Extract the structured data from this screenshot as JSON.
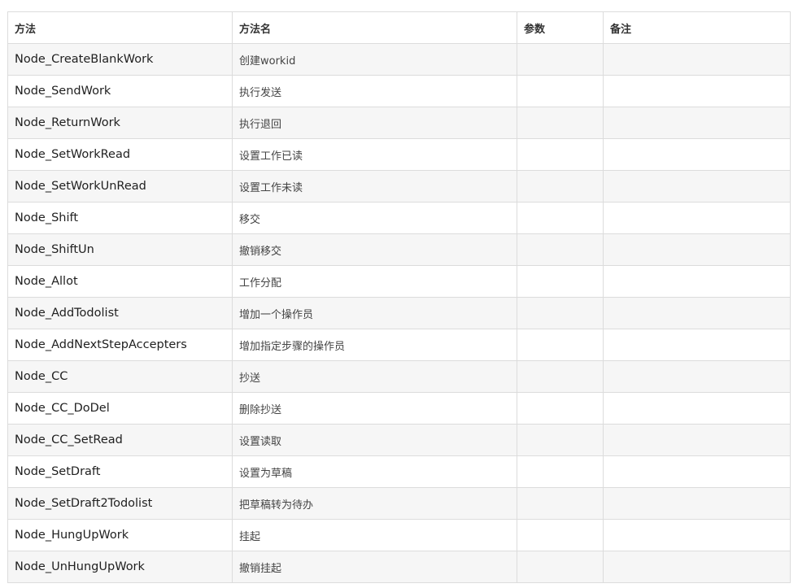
{
  "table": {
    "headers": [
      "方法",
      "方法名",
      "参数",
      "备注"
    ],
    "rows": [
      {
        "method": "Node_CreateBlankWork",
        "name": "创建workid",
        "params": "",
        "note": ""
      },
      {
        "method": "Node_SendWork",
        "name": "执行发送",
        "params": "",
        "note": ""
      },
      {
        "method": "Node_ReturnWork",
        "name": "执行退回",
        "params": "",
        "note": ""
      },
      {
        "method": "Node_SetWorkRead",
        "name": "设置工作已读",
        "params": "",
        "note": ""
      },
      {
        "method": "Node_SetWorkUnRead",
        "name": "设置工作未读",
        "params": "",
        "note": ""
      },
      {
        "method": "Node_Shift",
        "name": "移交",
        "params": "",
        "note": ""
      },
      {
        "method": "Node_ShiftUn",
        "name": "撤销移交",
        "params": "",
        "note": ""
      },
      {
        "method": "Node_Allot",
        "name": "工作分配",
        "params": "",
        "note": ""
      },
      {
        "method": "Node_AddTodolist",
        "name": "增加一个操作员",
        "params": "",
        "note": ""
      },
      {
        "method": "Node_AddNextStepAccepters",
        "name": "增加指定步骤的操作员",
        "params": "",
        "note": ""
      },
      {
        "method": "Node_CC",
        "name": "抄送",
        "params": "",
        "note": ""
      },
      {
        "method": "Node_CC_DoDel",
        "name": "删除抄送",
        "params": "",
        "note": ""
      },
      {
        "method": "Node_CC_SetRead",
        "name": "设置读取",
        "params": "",
        "note": ""
      },
      {
        "method": "Node_SetDraft",
        "name": "设置为草稿",
        "params": "",
        "note": ""
      },
      {
        "method": "Node_SetDraft2Todolist",
        "name": "把草稿转为待办",
        "params": "",
        "note": ""
      },
      {
        "method": "Node_HungUpWork",
        "name": "挂起",
        "params": "",
        "note": ""
      },
      {
        "method": "Node_UnHungUpWork",
        "name": "撤销挂起",
        "params": "",
        "note": ""
      }
    ]
  }
}
